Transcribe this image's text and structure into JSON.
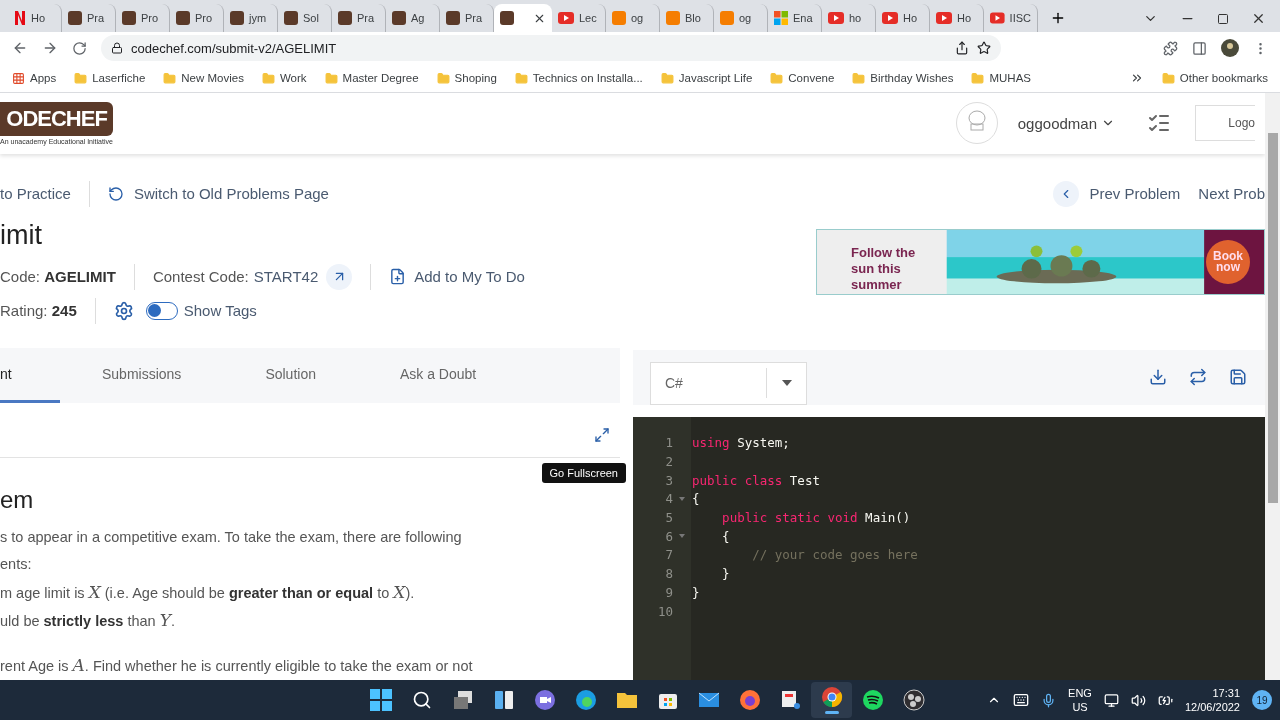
{
  "browser": {
    "tabs": [
      {
        "label": "Ho",
        "kind": "netflix",
        "selected": false
      },
      {
        "label": "Pra",
        "kind": "codechef",
        "selected": false
      },
      {
        "label": "Pro",
        "kind": "codechef",
        "selected": false
      },
      {
        "label": "Pro",
        "kind": "codechef",
        "selected": false
      },
      {
        "label": "jym",
        "kind": "codechef",
        "selected": false
      },
      {
        "label": "Sol",
        "kind": "codechef",
        "selected": false
      },
      {
        "label": "Pra",
        "kind": "codechef",
        "selected": false
      },
      {
        "label": "Ag",
        "kind": "codechef",
        "selected": false
      },
      {
        "label": "Pra",
        "kind": "codechef",
        "selected": false
      },
      {
        "kind": "codechef",
        "selected": true
      },
      {
        "label": "Lec",
        "kind": "youtube",
        "selected": false
      },
      {
        "label": "og",
        "kind": "blogger",
        "selected": false
      },
      {
        "label": "Blo",
        "kind": "blogger",
        "selected": false
      },
      {
        "label": "og",
        "kind": "blogger",
        "selected": false
      },
      {
        "label": "Ena",
        "kind": "microsoft",
        "selected": false
      },
      {
        "label": "ho",
        "kind": "youtube",
        "selected": false
      },
      {
        "label": "Ho",
        "kind": "youtube",
        "selected": false
      },
      {
        "label": "Ho",
        "kind": "youtube",
        "selected": false
      },
      {
        "label": "IISC",
        "kind": "youtube",
        "selected": false
      }
    ],
    "address": "codechef.com/submit-v2/AGELIMIT",
    "bookmarks": [
      {
        "label": "Apps",
        "kind": "apps"
      },
      {
        "label": "Laserfiche",
        "kind": "folder"
      },
      {
        "label": "New Movies",
        "kind": "folder"
      },
      {
        "label": "Work",
        "kind": "folder"
      },
      {
        "label": "Master Degree",
        "kind": "folder"
      },
      {
        "label": "Shoping",
        "kind": "folder"
      },
      {
        "label": "Technics on Installa...",
        "kind": "folder"
      },
      {
        "label": "Javascript Life",
        "kind": "folder"
      },
      {
        "label": "Convene",
        "kind": "folder"
      },
      {
        "label": "Birthday Wishes",
        "kind": "folder"
      },
      {
        "label": "MUHAS",
        "kind": "folder"
      }
    ],
    "other_bookmarks": "Other bookmarks"
  },
  "site_header": {
    "logo": "ODECHEF",
    "tagline": "An unacademy Educational Initiative",
    "username": "oggoodman",
    "logout": "Logo"
  },
  "nav": {
    "back": "to Practice",
    "switch": "Switch to Old Problems Page",
    "prev": "Prev Problem",
    "next": "Next Prob"
  },
  "problem": {
    "title": "imit",
    "code": "Code: **AGELIMIT**",
    "contest_label": "Contest Code:",
    "contest_code": "START42",
    "todo": "Add to My To Do",
    "rating": "Rating: **245**",
    "show_tags": {
      "label": "Show Tags",
      "on": false
    }
  },
  "ad": {
    "headline": "Follow the sun this summer",
    "button": "Book now"
  },
  "problem_tabs": [
    {
      "label": "nt",
      "selected": true
    },
    {
      "label": "Submissions",
      "selected": false
    },
    {
      "label": "Solution",
      "selected": false
    },
    {
      "label": "Ask a Doubt",
      "selected": false
    }
  ],
  "tooltip": "Go Fullscreen",
  "statement": {
    "heading": "em",
    "lines": [
      "s to appear in a competitive exam. To take the exam, there are following",
      "ents:",
      "m age limit is *X* (i.e. Age should be **greater than or equal** to *X*).",
      "uld be **strictly less** than *Y*.",
      "rent Age is *A*. Find whether he is currently eligible to take the exam or not"
    ]
  },
  "editor": {
    "language": "C#",
    "lines": [
      {
        "number": "1",
        "fold": false,
        "tokens": [
          {
            "text": "using",
            "kind": "keyword"
          },
          {
            "text": " System;",
            "kind": "plain"
          }
        ]
      },
      {
        "number": "2",
        "fold": false
      },
      {
        "number": "3",
        "fold": false,
        "tokens": [
          {
            "text": "public class",
            "kind": "keyword"
          },
          {
            "text": " Test",
            "kind": "plain"
          }
        ]
      },
      {
        "number": "4",
        "fold": true,
        "tokens": [
          {
            "text": "{",
            "kind": "plain"
          }
        ]
      },
      {
        "number": "5",
        "fold": false,
        "tokens": [
          {
            "text": "    public static void",
            "kind": "keyword"
          },
          {
            "text": " Main()",
            "kind": "plain"
          }
        ]
      },
      {
        "number": "6",
        "fold": true,
        "tokens": [
          {
            "text": "    {",
            "kind": "plain"
          }
        ]
      },
      {
        "number": "7",
        "fold": false,
        "tokens": [
          {
            "text": "        // your code goes here",
            "kind": "comment"
          }
        ]
      },
      {
        "number": "8",
        "fold": false,
        "tokens": [
          {
            "text": "    }",
            "kind": "plain"
          }
        ]
      },
      {
        "number": "9",
        "fold": false,
        "tokens": [
          {
            "text": "}",
            "kind": "plain"
          }
        ]
      },
      {
        "number": "10",
        "fold": false
      }
    ]
  },
  "taskbar": {
    "apps": [
      {
        "kind": "start",
        "selected": false
      },
      {
        "kind": "search",
        "selected": false
      },
      {
        "kind": "taskview",
        "selected": false
      },
      {
        "kind": "widgets",
        "selected": false
      },
      {
        "kind": "chat",
        "selected": false
      },
      {
        "kind": "edge",
        "selected": false
      },
      {
        "kind": "files",
        "selected": false
      },
      {
        "kind": "store",
        "selected": false
      },
      {
        "kind": "mail",
        "selected": false
      },
      {
        "kind": "firefox",
        "selected": false
      },
      {
        "kind": "snip",
        "selected": false
      },
      {
        "kind": "chrome",
        "selected": true
      },
      {
        "kind": "spotify",
        "selected": false
      },
      {
        "kind": "obs",
        "selected": false
      }
    ],
    "lang": "ENG",
    "region": "US",
    "time": "17:31",
    "date": "12/06/2022",
    "badge": "19"
  }
}
